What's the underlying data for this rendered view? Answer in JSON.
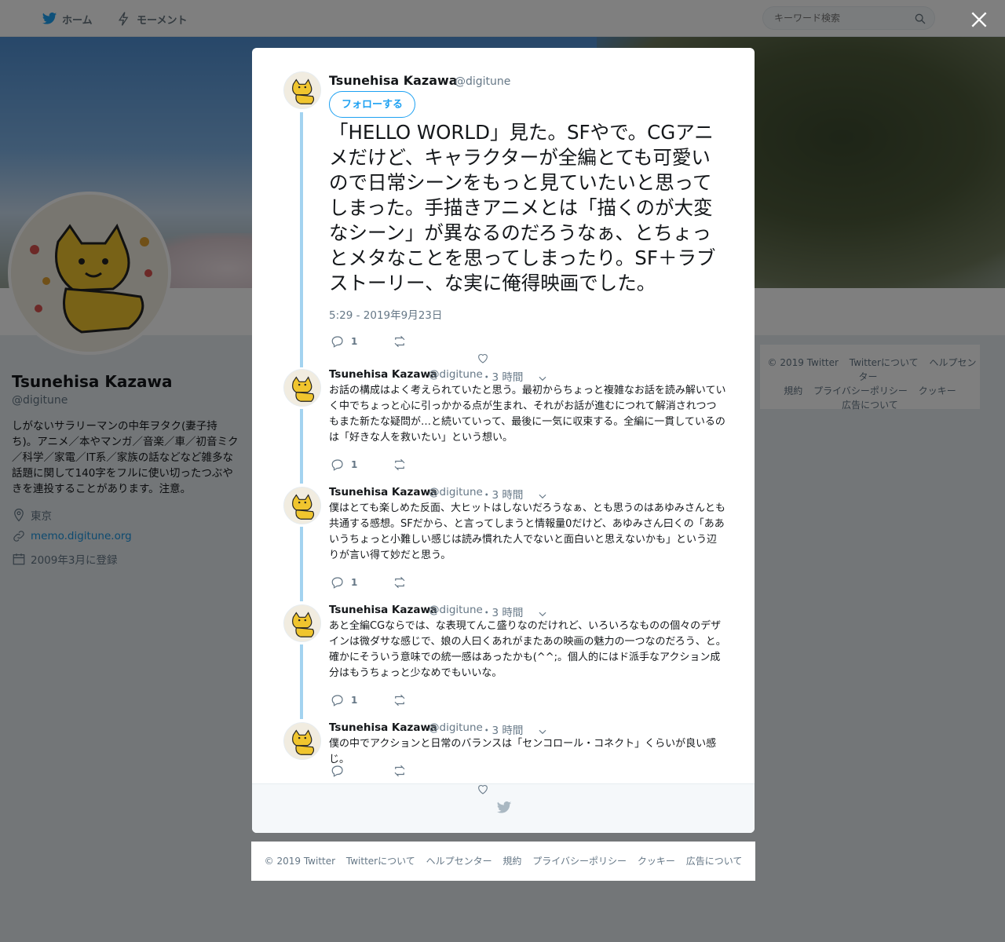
{
  "nav": {
    "home_label": "ホーム",
    "moments_label": "モーメント",
    "search_placeholder": "キーワード検索"
  },
  "profile": {
    "name": "Tsunehisa Kazawa",
    "handle": "@digitune",
    "bio": "しがないサラリーマンの中年ヲタク(妻子持ち)。アニメ／本やマンガ／音楽／車／初音ミク／科学／家電／IT系／家族の話などなど雑多な話題に関して140字をフルに使い切ったつぶやきを連投することがあります。注意。",
    "location": "東京",
    "url": "memo.digitune.org",
    "joined": "2009年3月に登録"
  },
  "right_footer": {
    "links": [
      "© 2019 Twitter",
      "Twitterについて",
      "ヘルプセンター",
      "規約",
      "プライバシーポリシー",
      "クッキー",
      "広告について"
    ]
  },
  "main_tweet": {
    "name": "Tsunehisa Kazawa",
    "handle": "@digitune",
    "follow_label": "フォローする",
    "text": "「HELLO WORLD」見た。SFやで。CGアニメだけど、キャラクターが全編とても可愛いので日常シーンをもっと見ていたいと思ってしまった。手描きアニメとは「描くのが大変なシーン」が異なるのだろうなぁ、とちょっとメタなことを思ってしまったり。SF＋ラブストーリー、な実に俺得映画でした。",
    "timestamp": "5:29 - 2019年9月23日",
    "reply_count": "1"
  },
  "replies": [
    {
      "name": "Tsunehisa Kazawa",
      "handle": "@digitune",
      "time": "・3 時間",
      "text": "お話の構成はよく考えられていたと思う。最初からちょっと複雑なお話を読み解いていく中でちょっと心に引っかかる点が生まれ、それがお話が進むにつれて解消されつつもまた新たな疑問が…と続いていって、最後に一気に収束する。全編に一貫しているのは「好きな人を救いたい」という想い。",
      "reply_count": "1"
    },
    {
      "name": "Tsunehisa Kazawa",
      "handle": "@digitune",
      "time": "・3 時間",
      "text": "僕はとても楽しめた反面、大ヒットはしないだろうなぁ、とも思うのはあゆみさんとも共通する感想。SFだから、と言ってしまうと情報量0だけど、あゆみさん曰くの「ああいうちょっと小難しい感じは読み慣れた人でないと面白いと思えないかも」という辺りが言い得て妙だと思う。",
      "reply_count": "1"
    },
    {
      "name": "Tsunehisa Kazawa",
      "handle": "@digitune",
      "time": "・3 時間",
      "text": "あと全編CGならでは、な表現てんこ盛りなのだけれど、いろいろなものの個々のデザインは微ダサな感じで、娘の人曰くあれがまたあの映画の魅力の一つなのだろう、と。確かにそういう意味での統一感はあったかも(^^;。個人的にはド派手なアクション成分はもうちょっと少なめでもいいな。",
      "reply_count": "1"
    },
    {
      "name": "Tsunehisa Kazawa",
      "handle": "@digitune",
      "time": "・3 時間",
      "text": "僕の中でアクションと日常のバランスは「センコロール・コネクト」くらいが良い感じ。",
      "reply_count": ""
    }
  ],
  "bottom_footer": {
    "links": [
      "© 2019 Twitter",
      "Twitterについて",
      "ヘルプセンター",
      "規約",
      "プライバシーポリシー",
      "クッキー",
      "広告について"
    ]
  },
  "colors": {
    "accent": "#1da1f2",
    "thread_line": "#a3d3f0",
    "muted": "#657786"
  }
}
